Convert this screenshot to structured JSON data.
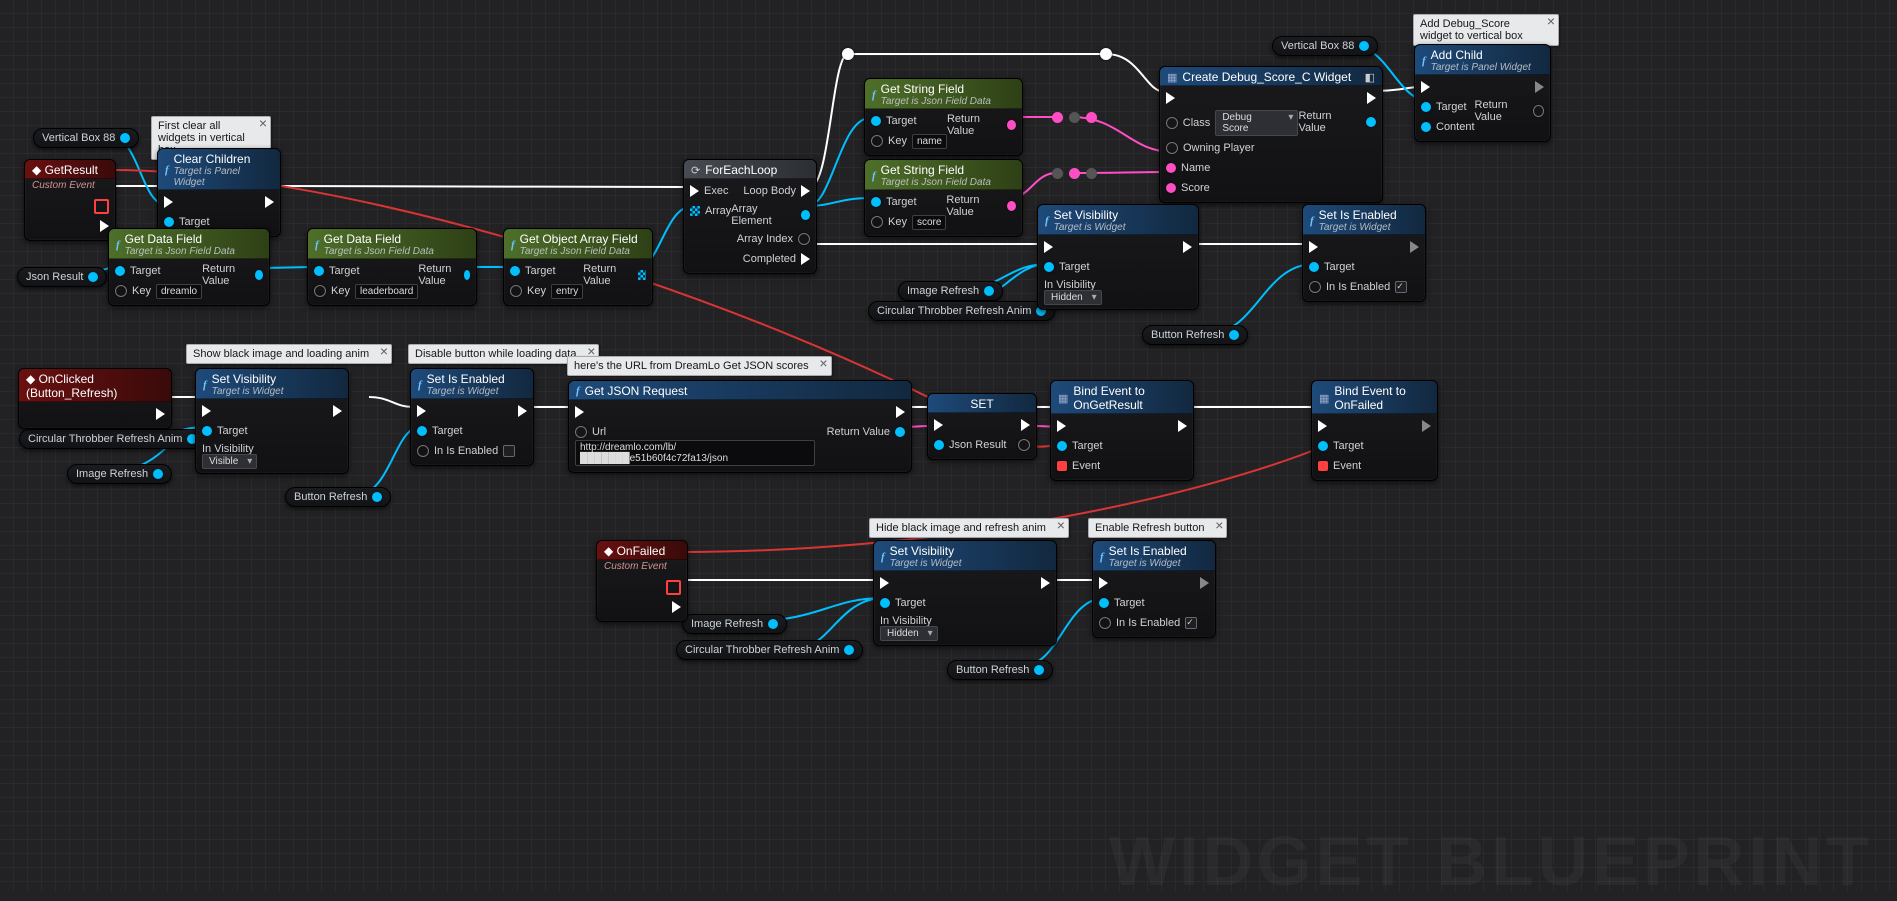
{
  "watermark": "WIDGET BLUEPRINT",
  "pills": {
    "vbox88a": "Vertical Box 88",
    "json_result": "Json Result",
    "circ_anim1": "Circular Throbber Refresh Anim",
    "image_refresh1": "Image Refresh",
    "button_refresh1": "Button Refresh",
    "image_refresh2": "Image Refresh",
    "circ_anim2": "Circular Throbber Refresh Anim",
    "vbox88b": "Vertical Box 88",
    "button_refresh2": "Button Refresh",
    "image_refresh3": "Image Refresh",
    "circ_anim3": "Circular Throbber Refresh Anim",
    "button_refresh3": "Button Refresh"
  },
  "comments": {
    "c1": "First clear all widgets in vertical box",
    "c2": "Show black image and loading anim",
    "c3": "Disable button while loading data",
    "c4": "here's the URL from DreamLo Get JSON scores",
    "c5": "Hide black image and refresh anim",
    "c6": "Enable Refresh button",
    "c7": "Add Debug_Score widget to vertical box"
  },
  "events": {
    "getresult": {
      "title": "GetResult",
      "sub": "Custom Event"
    },
    "onclicked": {
      "title": "OnClicked (Button_Refresh)"
    },
    "onfailed": {
      "title": "OnFailed",
      "sub": "Custom Event"
    }
  },
  "nodes": {
    "clear_children": {
      "title": "Clear Children",
      "sub": "Target is Panel Widget",
      "target": "Target"
    },
    "get_data1": {
      "title": "Get Data Field",
      "sub": "Target is Json Field Data",
      "target": "Target",
      "key_label": "Key",
      "key": "dreamlo",
      "rv": "Return Value"
    },
    "get_data2": {
      "title": "Get Data Field",
      "sub": "Target is Json Field Data",
      "target": "Target",
      "key_label": "Key",
      "key": "leaderboard",
      "rv": "Return Value"
    },
    "get_array": {
      "title": "Get Object Array Field",
      "sub": "Target is Json Field Data",
      "target": "Target",
      "key_label": "Key",
      "key": "entry",
      "rv": "Return Value"
    },
    "foreach": {
      "title": "ForEachLoop",
      "exec": "Exec",
      "array": "Array",
      "loop": "Loop Body",
      "elem": "Array Element",
      "idx": "Array Index",
      "done": "Completed"
    },
    "get_string_name": {
      "title": "Get String Field",
      "sub": "Target is Json Field Data",
      "target": "Target",
      "key_label": "Key",
      "key": "name",
      "rv": "Return Value"
    },
    "get_string_score": {
      "title": "Get String Field",
      "sub": "Target is Json Field Data",
      "target": "Target",
      "key_label": "Key",
      "key": "score",
      "rv": "Return Value"
    },
    "create_widget": {
      "title": "Create Debug_Score_C Widget",
      "class_l": "Class",
      "class_v": "Debug Score",
      "owning": "Owning Player",
      "name": "Name",
      "score": "Score",
      "rv": "Return Value"
    },
    "add_child": {
      "title": "Add Child",
      "sub": "Target is Panel Widget",
      "target": "Target",
      "content": "Content",
      "rv": "Return Value"
    },
    "setvis_top": {
      "title": "Set Visibility",
      "sub": "Target is Widget",
      "target": "Target",
      "vis_l": "In Visibility",
      "vis_v": "Hidden"
    },
    "setenabled_top": {
      "title": "Set Is Enabled",
      "sub": "Target is Widget",
      "target": "Target",
      "en_l": "In Is Enabled",
      "checked": true
    },
    "setvis_show": {
      "title": "Set Visibility",
      "sub": "Target is Widget",
      "target": "Target",
      "vis_l": "In Visibility",
      "vis_v": "Visible"
    },
    "setenabled_off": {
      "title": "Set Is Enabled",
      "sub": "Target is Widget",
      "target": "Target",
      "en_l": "In Is Enabled",
      "checked": false
    },
    "get_json": {
      "title": "Get JSON Request",
      "url_l": "Url",
      "url_v": "http://dreamlo.com/lb/███████e51b60f4c72fa13/json",
      "rv": "Return Value"
    },
    "setvar": {
      "title": "SET",
      "var": "Json Result"
    },
    "bind_get": {
      "title": "Bind Event to OnGetResult",
      "target": "Target",
      "event": "Event"
    },
    "bind_fail": {
      "title": "Bind Event to OnFailed",
      "target": "Target",
      "event": "Event"
    },
    "setvis_hide": {
      "title": "Set Visibility",
      "sub": "Target is Widget",
      "target": "Target",
      "vis_l": "In Visibility",
      "vis_v": "Hidden"
    },
    "setenabled_on": {
      "title": "Set Is Enabled",
      "sub": "Target is Widget",
      "target": "Target",
      "en_l": "In Is Enabled",
      "checked": true
    }
  }
}
